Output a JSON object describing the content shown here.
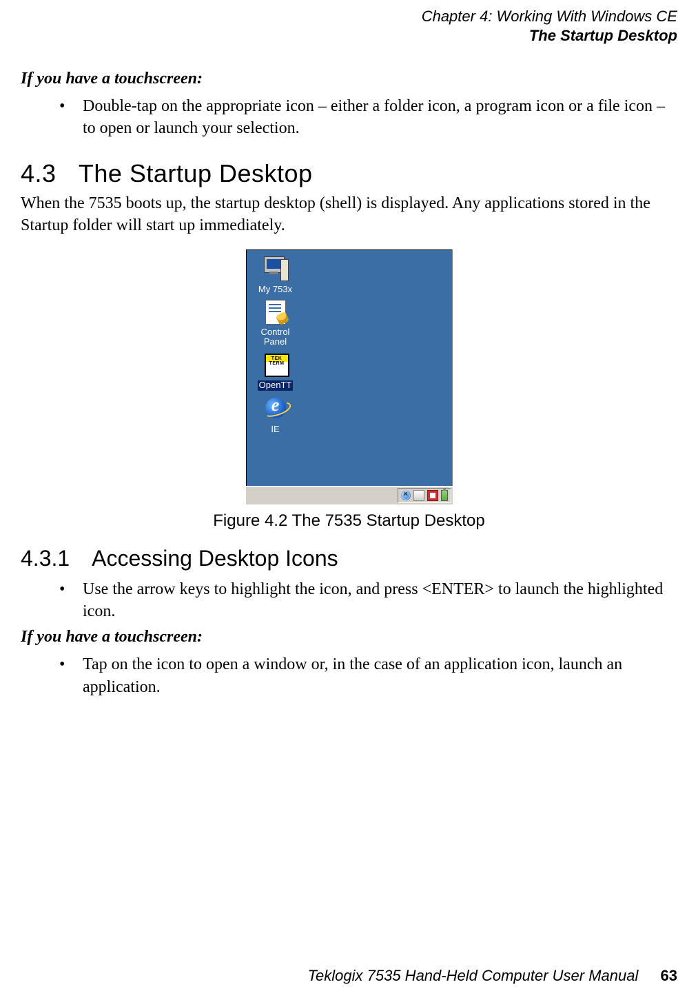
{
  "header": {
    "chapter_line": "Chapter  4:  Working With Windows CE",
    "section_line": "The Startup Desktop"
  },
  "intro": {
    "touch_heading": "If you have a touchscreen:",
    "touch_bullet": "Double-tap on the appropriate icon – either a folder icon, a program icon or a file icon – to open or launch your selection."
  },
  "sec43": {
    "num": "4.3",
    "title": "The Startup Desktop",
    "para": "When the 7535 boots up, the startup desktop (shell) is displayed. Any applications stored in the Startup folder will start up immediately."
  },
  "figure": {
    "caption": "Figure 4.2 The 7535 Startup Desktop",
    "desktop": {
      "icons": [
        {
          "label": "My 753x",
          "type": "computer",
          "selected": false
        },
        {
          "label": "Control Panel",
          "type": "cpl",
          "selected": false
        },
        {
          "label": "OpenTT",
          "type": "tekterm",
          "selected": true,
          "tek1": "TEK",
          "tek2": "TERM"
        },
        {
          "label": "IE",
          "type": "ie",
          "selected": false
        }
      ],
      "tray_icons": [
        "globe-x",
        "recycle",
        "red-app",
        "battery"
      ]
    }
  },
  "sec431": {
    "num": "4.3.1",
    "title": "Accessing Desktop Icons",
    "bullet": "Use the arrow keys to highlight the icon, and press <ENTER> to launch the highlighted icon.",
    "touch_heading": "If you have a touchscreen:",
    "touch_bullet": "Tap on the icon to open a window or, in the case of an application icon, launch an application."
  },
  "footer": {
    "manual": "Teklogix 7535 Hand-Held Computer User Manual",
    "page": "63"
  }
}
